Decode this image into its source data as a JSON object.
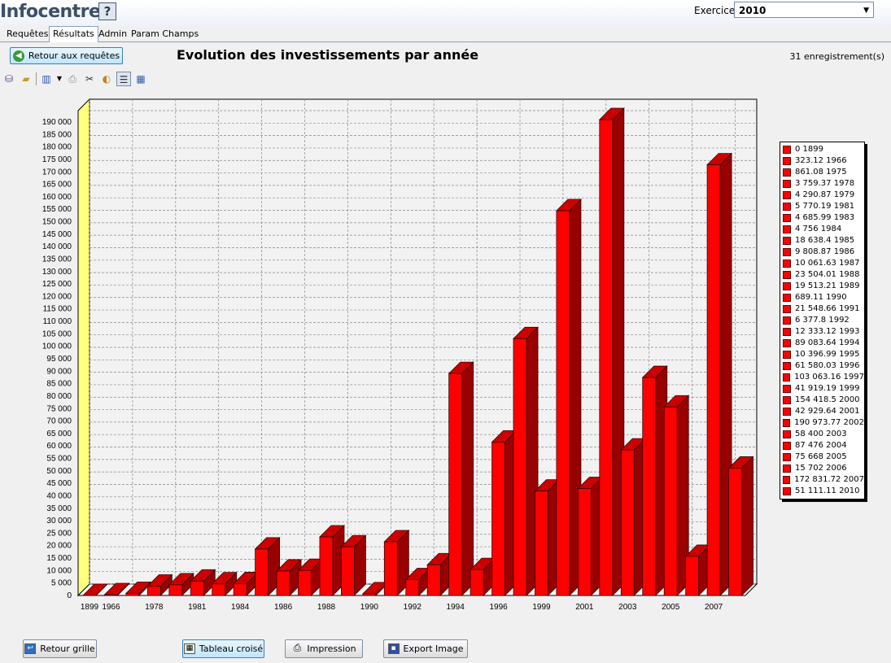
{
  "app": {
    "title": "Infocentre",
    "help": "?"
  },
  "exercice": {
    "label": "Exercice",
    "value": "2010"
  },
  "tabs": [
    {
      "label": "Requêtes",
      "active": false
    },
    {
      "label": "Résultats",
      "active": true
    },
    {
      "label": "Admin",
      "active": false
    },
    {
      "label": "Param Champs",
      "active": false
    }
  ],
  "back_to_queries": "Retour aux requêtes",
  "records_label": "31  enregistrement(s)",
  "toolbar_icons": [
    "database-icon",
    "open-folder-icon",
    "bar-chart-icon",
    "dropdown-arrow-icon",
    "printer-icon",
    "scissors-icon",
    "palette-icon",
    "legend-toggle-icon",
    "grid-icon"
  ],
  "colors": {
    "bar_front": "#ff0000",
    "bar_side": "#990000",
    "bar_top": "#cc0000",
    "wall_left": "#ffff80"
  },
  "chart_data": {
    "type": "bar",
    "title": "Evolution des investissements par année",
    "ylim": [
      0,
      190000
    ],
    "grid": true,
    "legend": "right",
    "categories": [
      "1899",
      "1966",
      "1975",
      "1978",
      "1979",
      "1981",
      "1983",
      "1984",
      "1985",
      "1986",
      "1987",
      "1988",
      "1989",
      "1990",
      "1991",
      "1992",
      "1993",
      "1994",
      "1995",
      "1996",
      "1997",
      "1999",
      "2000",
      "2001",
      "2002",
      "2003",
      "2004",
      "2005",
      "2006",
      "2007",
      "2010"
    ],
    "x_tick_labels": [
      "1899",
      "1966",
      "",
      "1978",
      "",
      "1981",
      "",
      "1984",
      "",
      "1986",
      "",
      "1988",
      "",
      "1990",
      "",
      "1992",
      "",
      "1994",
      "",
      "1996",
      "",
      "1999",
      "",
      "2001",
      "",
      "2003",
      "",
      "2005",
      "",
      "2007",
      ""
    ],
    "y_ticks": [
      "0",
      "5 000",
      "10 000",
      "15 000",
      "20 000",
      "25 000",
      "30 000",
      "35 000",
      "40 000",
      "45 000",
      "50 000",
      "55 000",
      "60 000",
      "65 000",
      "70 000",
      "75 000",
      "80 000",
      "85 000",
      "90 000",
      "95 000",
      "100 000",
      "105 000",
      "110 000",
      "115 000",
      "120 000",
      "125 000",
      "130 000",
      "135 000",
      "140 000",
      "145 000",
      "150 000",
      "155 000",
      "160 000",
      "165 000",
      "170 000",
      "175 000",
      "180 000",
      "185 000",
      "190 000"
    ],
    "values": [
      0,
      323.12,
      861.08,
      3759.37,
      4290.87,
      5770.19,
      4685.99,
      4756,
      18638.4,
      9808.87,
      10061.63,
      23504.01,
      19513.21,
      689.11,
      21548.66,
      6377.8,
      12333.12,
      89083.64,
      10396.99,
      61580.03,
      103063.16,
      41919.19,
      154418.5,
      42929.64,
      190973.77,
      58400,
      87476,
      75668,
      15702,
      172831.72,
      51111.11
    ],
    "legend_entries": [
      "0 1899",
      "323.12 1966",
      "861.08 1975",
      "3 759.37 1978",
      "4 290.87 1979",
      "5 770.19 1981",
      "4 685.99 1983",
      "4 756 1984",
      "18 638.4 1985",
      "9 808.87 1986",
      "10 061.63 1987",
      "23 504.01 1988",
      "19 513.21 1989",
      "689.11 1990",
      "21 548.66 1991",
      "6 377.8 1992",
      "12 333.12 1993",
      "89 083.64 1994",
      "10 396.99 1995",
      "61 580.03 1996",
      "103 063.16 1997",
      "41 919.19 1999",
      "154 418.5 2000",
      "42 929.64 2001",
      "190 973.77 2002",
      "58 400 2003",
      "87 476 2004",
      "75 668 2005",
      "15 702 2006",
      "172 831.72 2007",
      "51 111.11 2010"
    ]
  },
  "bottom_buttons": {
    "back_grid": "Retour grille",
    "crosstab": "Tableau croisé",
    "print": "Impression",
    "export": "Export Image"
  }
}
